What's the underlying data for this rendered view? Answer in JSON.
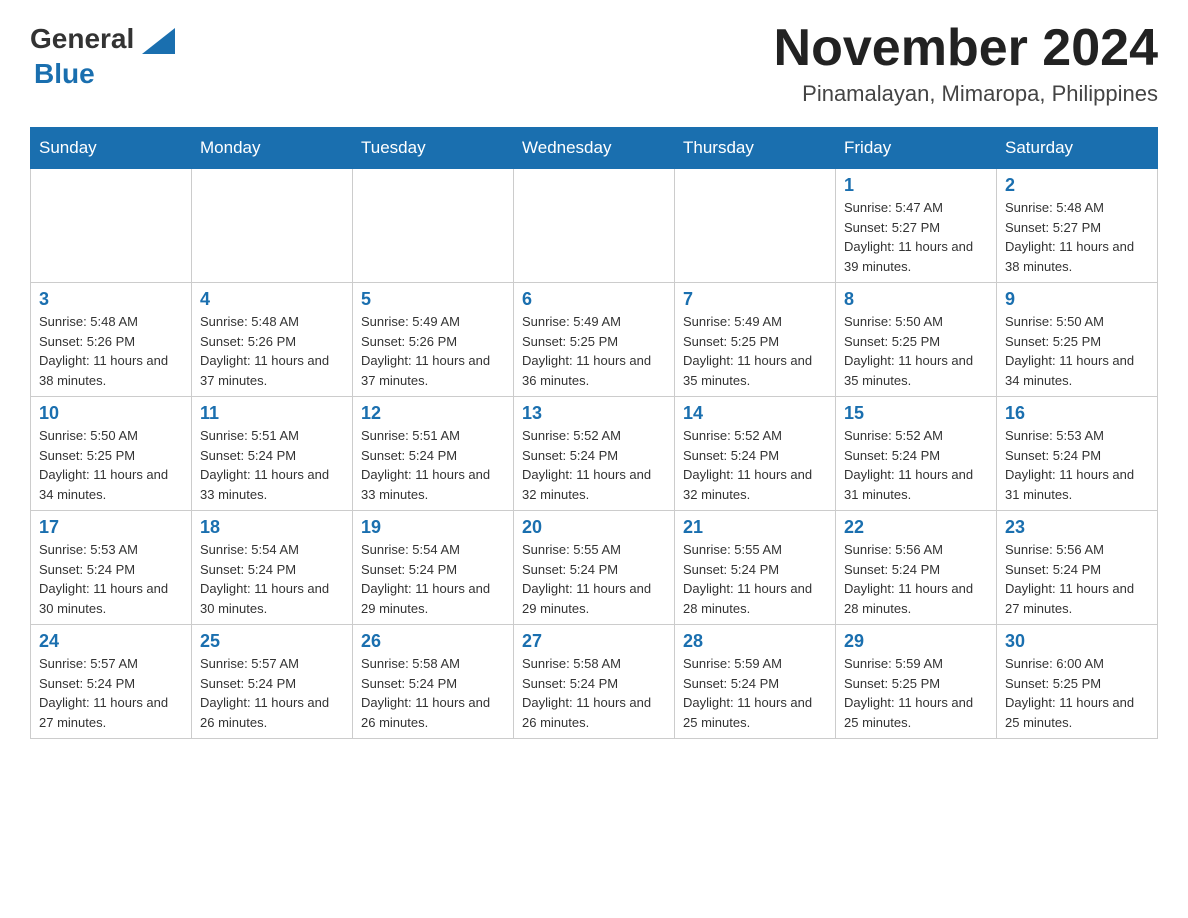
{
  "header": {
    "logo": {
      "general": "General",
      "blue": "Blue"
    },
    "title": "November 2024",
    "location": "Pinamalayan, Mimaropa, Philippines"
  },
  "calendar": {
    "days_of_week": [
      "Sunday",
      "Monday",
      "Tuesday",
      "Wednesday",
      "Thursday",
      "Friday",
      "Saturday"
    ],
    "weeks": [
      [
        {
          "day": "",
          "info": ""
        },
        {
          "day": "",
          "info": ""
        },
        {
          "day": "",
          "info": ""
        },
        {
          "day": "",
          "info": ""
        },
        {
          "day": "",
          "info": ""
        },
        {
          "day": "1",
          "info": "Sunrise: 5:47 AM\nSunset: 5:27 PM\nDaylight: 11 hours and 39 minutes."
        },
        {
          "day": "2",
          "info": "Sunrise: 5:48 AM\nSunset: 5:27 PM\nDaylight: 11 hours and 38 minutes."
        }
      ],
      [
        {
          "day": "3",
          "info": "Sunrise: 5:48 AM\nSunset: 5:26 PM\nDaylight: 11 hours and 38 minutes."
        },
        {
          "day": "4",
          "info": "Sunrise: 5:48 AM\nSunset: 5:26 PM\nDaylight: 11 hours and 37 minutes."
        },
        {
          "day": "5",
          "info": "Sunrise: 5:49 AM\nSunset: 5:26 PM\nDaylight: 11 hours and 37 minutes."
        },
        {
          "day": "6",
          "info": "Sunrise: 5:49 AM\nSunset: 5:25 PM\nDaylight: 11 hours and 36 minutes."
        },
        {
          "day": "7",
          "info": "Sunrise: 5:49 AM\nSunset: 5:25 PM\nDaylight: 11 hours and 35 minutes."
        },
        {
          "day": "8",
          "info": "Sunrise: 5:50 AM\nSunset: 5:25 PM\nDaylight: 11 hours and 35 minutes."
        },
        {
          "day": "9",
          "info": "Sunrise: 5:50 AM\nSunset: 5:25 PM\nDaylight: 11 hours and 34 minutes."
        }
      ],
      [
        {
          "day": "10",
          "info": "Sunrise: 5:50 AM\nSunset: 5:25 PM\nDaylight: 11 hours and 34 minutes."
        },
        {
          "day": "11",
          "info": "Sunrise: 5:51 AM\nSunset: 5:24 PM\nDaylight: 11 hours and 33 minutes."
        },
        {
          "day": "12",
          "info": "Sunrise: 5:51 AM\nSunset: 5:24 PM\nDaylight: 11 hours and 33 minutes."
        },
        {
          "day": "13",
          "info": "Sunrise: 5:52 AM\nSunset: 5:24 PM\nDaylight: 11 hours and 32 minutes."
        },
        {
          "day": "14",
          "info": "Sunrise: 5:52 AM\nSunset: 5:24 PM\nDaylight: 11 hours and 32 minutes."
        },
        {
          "day": "15",
          "info": "Sunrise: 5:52 AM\nSunset: 5:24 PM\nDaylight: 11 hours and 31 minutes."
        },
        {
          "day": "16",
          "info": "Sunrise: 5:53 AM\nSunset: 5:24 PM\nDaylight: 11 hours and 31 minutes."
        }
      ],
      [
        {
          "day": "17",
          "info": "Sunrise: 5:53 AM\nSunset: 5:24 PM\nDaylight: 11 hours and 30 minutes."
        },
        {
          "day": "18",
          "info": "Sunrise: 5:54 AM\nSunset: 5:24 PM\nDaylight: 11 hours and 30 minutes."
        },
        {
          "day": "19",
          "info": "Sunrise: 5:54 AM\nSunset: 5:24 PM\nDaylight: 11 hours and 29 minutes."
        },
        {
          "day": "20",
          "info": "Sunrise: 5:55 AM\nSunset: 5:24 PM\nDaylight: 11 hours and 29 minutes."
        },
        {
          "day": "21",
          "info": "Sunrise: 5:55 AM\nSunset: 5:24 PM\nDaylight: 11 hours and 28 minutes."
        },
        {
          "day": "22",
          "info": "Sunrise: 5:56 AM\nSunset: 5:24 PM\nDaylight: 11 hours and 28 minutes."
        },
        {
          "day": "23",
          "info": "Sunrise: 5:56 AM\nSunset: 5:24 PM\nDaylight: 11 hours and 27 minutes."
        }
      ],
      [
        {
          "day": "24",
          "info": "Sunrise: 5:57 AM\nSunset: 5:24 PM\nDaylight: 11 hours and 27 minutes."
        },
        {
          "day": "25",
          "info": "Sunrise: 5:57 AM\nSunset: 5:24 PM\nDaylight: 11 hours and 26 minutes."
        },
        {
          "day": "26",
          "info": "Sunrise: 5:58 AM\nSunset: 5:24 PM\nDaylight: 11 hours and 26 minutes."
        },
        {
          "day": "27",
          "info": "Sunrise: 5:58 AM\nSunset: 5:24 PM\nDaylight: 11 hours and 26 minutes."
        },
        {
          "day": "28",
          "info": "Sunrise: 5:59 AM\nSunset: 5:24 PM\nDaylight: 11 hours and 25 minutes."
        },
        {
          "day": "29",
          "info": "Sunrise: 5:59 AM\nSunset: 5:25 PM\nDaylight: 11 hours and 25 minutes."
        },
        {
          "day": "30",
          "info": "Sunrise: 6:00 AM\nSunset: 5:25 PM\nDaylight: 11 hours and 25 minutes."
        }
      ]
    ]
  }
}
